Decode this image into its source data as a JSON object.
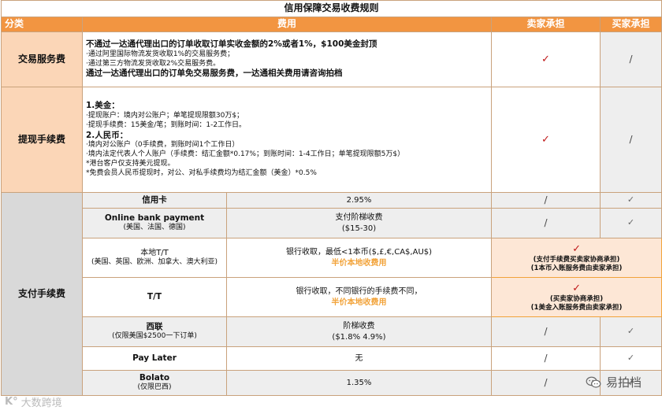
{
  "title": "信用保障交易收费规则",
  "header": {
    "category": "分类",
    "fee": "费用",
    "seller": "卖家承担",
    "buyer": "买家承担"
  },
  "rows": {
    "trade": {
      "category": "交易服务费",
      "line1": "不通过一达通代理出口的订单收取订单实收金额的2%或者1%，$100美金封顶",
      "line2": "·通过阿里国际物流发货收取1%的交易服务费；",
      "line3": "·通过第三方物流发货收取2%交易服务费。",
      "line4": "通过一达通代理出口的订单免交易服务费，一达通相关费用请咨询拍档",
      "seller": "✓",
      "buyer": "/"
    },
    "withdraw": {
      "category": "提现手续费",
      "usd_title": "1.美金：",
      "usd_l1": "·提现账户：境内对公账户；单笔提现限额30万$；",
      "usd_l2": "·提现手续费：15美金/笔；到账时间：1-2工作日。",
      "rmb_title": "2.人民币：",
      "rmb_l1": "·境内对公账户（0手续费，到账时间1个工作日）",
      "rmb_l2": "·境内法定代表人个人账户（手续费：结汇金额*0.17%；到账时间：1-4工作日；单笔提现限额5万$）",
      "rmb_l3": "*港台客户仅支持美元提现。",
      "rmb_l4": "*免费会员人民币提现时，对公、对私手续费均为结汇金额（美金）*0.5%",
      "seller": "✓",
      "buyer": "/"
    },
    "payment": {
      "category": "支付手续费",
      "items": [
        {
          "name": "信用卡",
          "sub": "",
          "fee": "2.95%",
          "fee_note": "",
          "seller": "/",
          "buyer": "✓"
        },
        {
          "name": "Online bank payment",
          "sub": "(美国、法国、德国)",
          "fee": "支付阶梯收费",
          "fee2": "($15-30)",
          "seller": "/",
          "buyer": "✓"
        },
        {
          "name": "本地T/T",
          "sub": "(美国、英国、欧洲、加拿大、澳大利亚)",
          "fee": "银行收取，最低<1本币($,£,€,CA$,AU$)",
          "fee_note": "半价本地收费用",
          "seller_mark": "✓",
          "seller_n1": "(支付手续费买卖家协商承担)",
          "seller_n2": "(1本币入账服务费由卖家承担)"
        },
        {
          "name": "T/T",
          "sub": "",
          "fee": "银行收取，不同银行的手续费不同，",
          "fee_note": "半价本地收费用",
          "seller_mark": "✓",
          "seller_n1": "(买卖家协商承担)",
          "seller_n2": "(1美金入账服务费由卖家承担)"
        },
        {
          "name": "西联",
          "sub": "(仅限美国$2500一下订单)",
          "fee": "阶梯收费",
          "fee2": "($1.8% 4.9%)",
          "seller": "/",
          "buyer": "✓"
        },
        {
          "name": "Pay Later",
          "sub": "",
          "fee": "无",
          "seller": "/",
          "buyer": "✓"
        },
        {
          "name": "Bolato",
          "sub": "(仅限巴西)",
          "fee": "1.35%",
          "seller": "/",
          "buyer": "✓"
        }
      ]
    }
  },
  "watermark_left": "大数跨境",
  "watermark_right": "易拍档"
}
